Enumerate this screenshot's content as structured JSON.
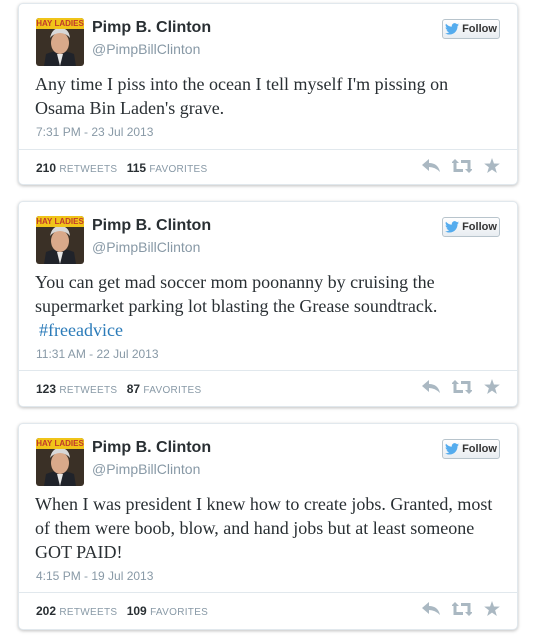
{
  "tweets": [
    {
      "name": "Pimp B. Clinton",
      "handle": "@PimpBillClinton",
      "follow_label": "Follow",
      "avatar_caption": "HAY LADIES",
      "text": "Any time I piss into the ocean I tell myself I'm pissing on Osama Bin Laden's grave.",
      "hashtag": "",
      "timestamp": "7:31 PM - 23 Jul 2013",
      "retweets": "210",
      "retweets_label": "RETWEETS",
      "favorites": "115",
      "favorites_label": "FAVORITES"
    },
    {
      "name": "Pimp B. Clinton",
      "handle": "@PimpBillClinton",
      "follow_label": "Follow",
      "avatar_caption": "HAY LADIES",
      "text": "You can get mad soccer mom poonanny by cruising the supermarket parking lot blasting the Grease soundtrack.",
      "hashtag": "#freeadvice",
      "timestamp": "11:31 AM - 22 Jul 2013",
      "retweets": "123",
      "retweets_label": "RETWEETS",
      "favorites": "87",
      "favorites_label": "FAVORITES"
    },
    {
      "name": "Pimp B. Clinton",
      "handle": "@PimpBillClinton",
      "follow_label": "Follow",
      "avatar_caption": "HAY LADIES",
      "text": "When I was president I knew how to create jobs. Granted, most of them were boob, blow, and hand jobs but at least someone GOT PAID!",
      "hashtag": "",
      "timestamp": "4:15 PM - 19 Jul 2013",
      "retweets": "202",
      "retweets_label": "RETWEETS",
      "favorites": "109",
      "favorites_label": "FAVORITES"
    }
  ],
  "icons": {
    "bird": "twitter-bird-icon",
    "reply": "reply-icon",
    "retweet": "retweet-icon",
    "favorite": "star-icon"
  },
  "colors": {
    "name": "#292f33",
    "meta": "#8899a6",
    "hashtag": "#2b7bb9",
    "bird": "#55acee",
    "action_icon": "#aab8c2"
  }
}
